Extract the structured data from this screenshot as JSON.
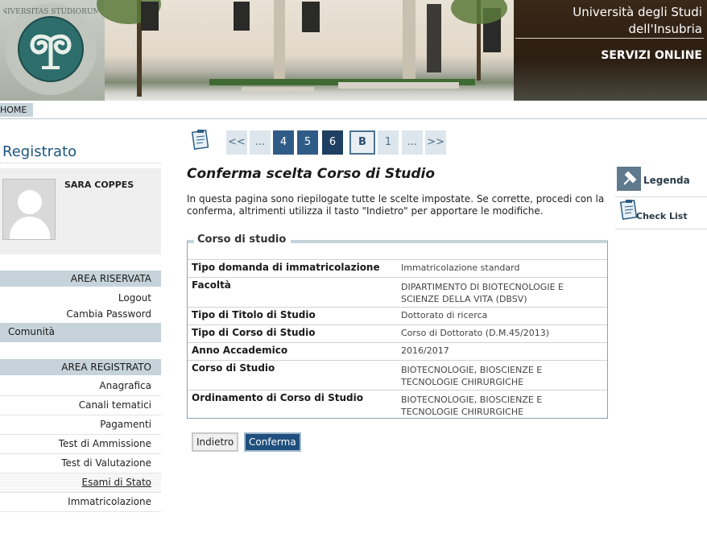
{
  "header": {
    "university_line1": "Università degli Studi",
    "university_line2": "dell'Insubria",
    "services": "SERVIZI ONLINE",
    "logo_icon": "university-seal-icon"
  },
  "nav": {
    "home": "HOME"
  },
  "sidebar": {
    "title": "Registrato",
    "user_name": "SARA COPPES",
    "area_riservata": {
      "header": "AREA RISERVATA",
      "items": [
        "Logout",
        "Cambia Password"
      ]
    },
    "comunita": "Comunità",
    "area_registrato": {
      "header": "AREA REGISTRATO",
      "items": [
        "Anagrafica",
        "Canali tematici",
        "Pagamenti",
        "Test di Ammissione",
        "Test di Valutazione",
        "Esami di Stato",
        "Immatricolazione"
      ]
    }
  },
  "wizard": {
    "first": "<<",
    "ellipsis_left": "...",
    "step4": "4",
    "step5": "5",
    "step6": "6",
    "stepB": "B",
    "step1": "1",
    "ellipsis_right": "...",
    "last": ">>"
  },
  "main": {
    "title": "Conferma scelta Corso di Studio",
    "intro": "In questa pagina sono riepilogate tutte le scelte impostate. Se corrette, procedi con la conferma, altrimenti utilizza il tasto \"Indietro\" per apportare le modifiche.",
    "section_title": "Corso di studio",
    "rows": [
      {
        "label": "Tipo domanda di immatricolazione",
        "value": "Immatricolazione standard"
      },
      {
        "label": "Facoltà",
        "value": "DIPARTIMENTO DI BIOTECNOLOGIE E SCIENZE DELLA VITA (DBSV)"
      },
      {
        "label": "Tipo di Titolo di Studio",
        "value": "Dottorato di ricerca"
      },
      {
        "label": "Tipo di Corso di Studio",
        "value": "Corso di Dottorato (D.M.45/2013)"
      },
      {
        "label": "Anno Accademico",
        "value": "2016/2017"
      },
      {
        "label": "Corso di Studio",
        "value": "BIOTECNOLOGIE, BIOSCIENZE E TECNOLOGIE CHIRURGICHE"
      },
      {
        "label": "Ordinamento di Corso di Studio",
        "value": "BIOTECNOLOGIE, BIOSCIENZE E TECNOLOGIE CHIRURGICHE"
      }
    ],
    "back_button": "Indietro",
    "confirm_button": "Conferma"
  },
  "right": {
    "legenda": "Legenda",
    "checklist": "Check List"
  },
  "colors": {
    "accent": "#1f3f62",
    "nav_bar": "#c6d3da",
    "title_blue": "#1a5580"
  }
}
